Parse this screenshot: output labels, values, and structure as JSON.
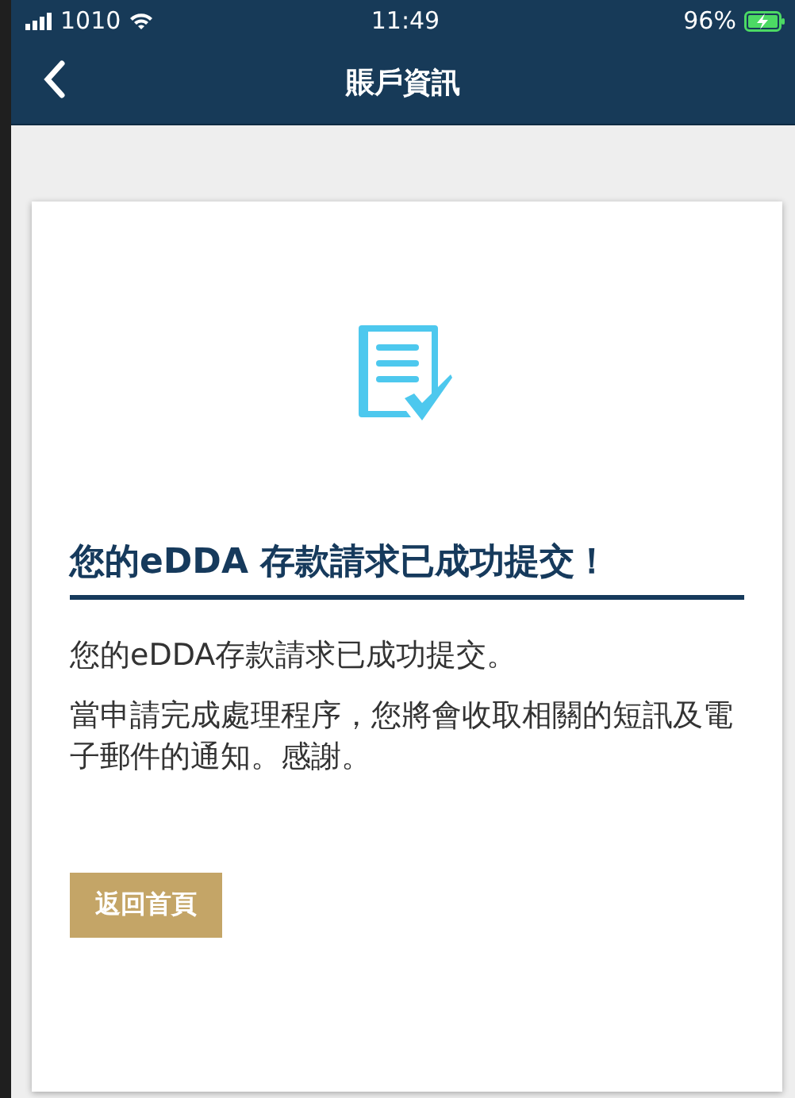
{
  "status_bar": {
    "carrier": "1010",
    "time": "11:49",
    "battery": "96%"
  },
  "nav": {
    "title": "賬戶資訊"
  },
  "card": {
    "heading": "您的eDDA 存款請求已成功提交！",
    "paragraphs": [
      "您的eDDA存款請求已成功提交。",
      "當申請完成處理程序，您將會收取相關的短訊及電子郵件的通知。感謝。"
    ],
    "button": "返回首頁"
  }
}
